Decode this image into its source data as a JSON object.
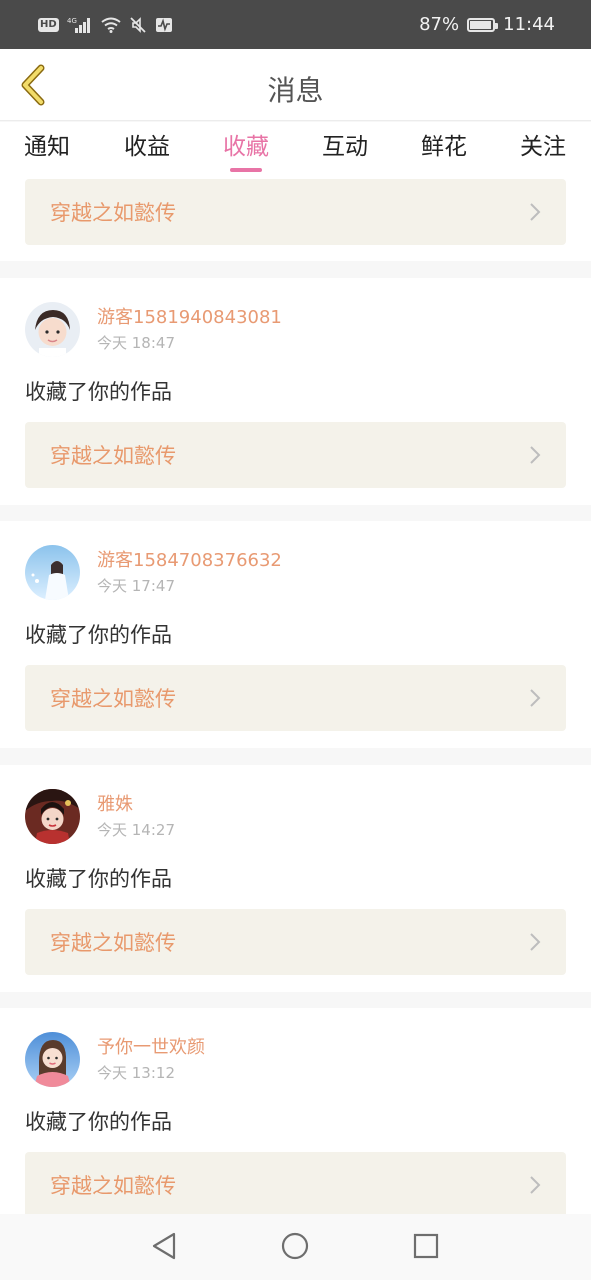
{
  "status_bar": {
    "hd": "HD",
    "signal_label": "4G",
    "battery": "87%",
    "time": "11:44",
    "battery_level": 0.87
  },
  "header": {
    "title": "消息",
    "back_icon": "chevron-left-icon"
  },
  "tabs": [
    {
      "label": "通知",
      "active": false
    },
    {
      "label": "收益",
      "active": false
    },
    {
      "label": "收藏",
      "active": true
    },
    {
      "label": "互动",
      "active": false
    },
    {
      "label": "鲜花",
      "active": false
    },
    {
      "label": "关注",
      "active": false
    }
  ],
  "top_partial": {
    "work_title": "穿越之如懿传"
  },
  "items": [
    {
      "user": "游客1581940843081",
      "time": "今天 18:47",
      "action": "收藏了你的作品",
      "work_title": "穿越之如懿传"
    },
    {
      "user": "游客1584708376632",
      "time": "今天 17:47",
      "action": "收藏了你的作品",
      "work_title": "穿越之如懿传"
    },
    {
      "user": "雅姝",
      "time": "今天 14:27",
      "action": "收藏了你的作品",
      "work_title": "穿越之如懿传"
    },
    {
      "user": "予你一世欢颜",
      "time": "今天 13:12",
      "action": "收藏了你的作品",
      "work_title": "穿越之如懿传"
    }
  ],
  "colors": {
    "accent_pink": "#e874a6",
    "username_orange": "#e89a73",
    "work_title_orange": "#e8996c",
    "work_bg": "#f4f2ea"
  },
  "nav_bar": {
    "back": "triangle-back-icon",
    "home": "circle-home-icon",
    "recents": "square-recents-icon"
  }
}
